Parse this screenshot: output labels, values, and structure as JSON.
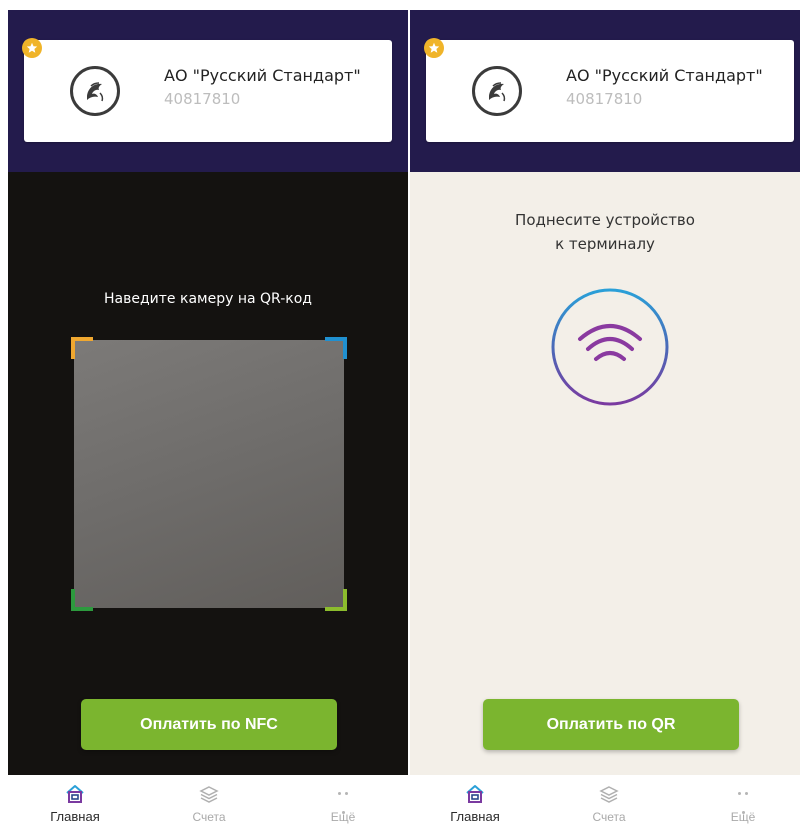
{
  "screens": [
    {
      "card": {
        "bank_name": "АО \"Русский Стандарт\"",
        "account": "40817810"
      },
      "prompt": "Наведите камеру на QR-код",
      "pay_button": "Оплатить по NFC",
      "tabs": [
        {
          "label": "Главная",
          "icon": "home-icon"
        },
        {
          "label": "Счета",
          "icon": "layers-icon"
        },
        {
          "label": "Ещё",
          "icon": "more-icon"
        }
      ]
    },
    {
      "card": {
        "bank_name": "АО \"Русский Стандарт\"",
        "account": "40817810"
      },
      "prompt_line1": "Поднесите устройство",
      "prompt_line2": "к терминалу",
      "pay_button": "Оплатить по QR",
      "tabs": [
        {
          "label": "Главная",
          "icon": "home-icon"
        },
        {
          "label": "Счета",
          "icon": "layers-icon"
        },
        {
          "label": "Ещё",
          "icon": "more-icon"
        }
      ]
    }
  ],
  "colors": {
    "header": "#231b4c",
    "accent_green": "#7bb52f",
    "favorite_badge": "#f0b429",
    "nfc_blue": "#2aa0d8",
    "nfc_purple": "#8a3aa0",
    "active_tab": "#2a4a8a"
  }
}
